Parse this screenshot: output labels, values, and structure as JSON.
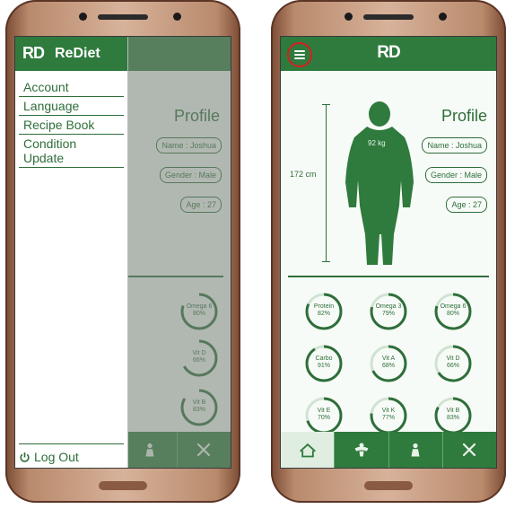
{
  "app": {
    "logo": "RD",
    "name": "ReDiet"
  },
  "drawer": {
    "items": [
      "Account",
      "Language",
      "Recipe Book",
      "Condition Update"
    ],
    "logout": "Log Out"
  },
  "profile": {
    "title": "Profile",
    "name": "Name : Joshua",
    "gender": "Gender : Male",
    "age": "Age : 27",
    "height": "172 cm",
    "weight": "92 kg"
  },
  "nutrients": [
    {
      "name": "Protein",
      "value": "82%"
    },
    {
      "name": "Omega 3",
      "value": "79%"
    },
    {
      "name": "Omega 6",
      "value": "80%"
    },
    {
      "name": "Carbo",
      "value": "91%"
    },
    {
      "name": "Vit A",
      "value": "68%"
    },
    {
      "name": "Vit D",
      "value": "66%"
    },
    {
      "name": "Vit E",
      "value": "70%"
    },
    {
      "name": "Vit K",
      "value": "77%"
    },
    {
      "name": "Vit B",
      "value": "83%"
    }
  ],
  "nav": {
    "items": [
      "home-icon",
      "fitness-icon",
      "profile-icon",
      "tools-icon"
    ],
    "active": 0
  },
  "colors": {
    "primary": "#2f7a3d",
    "highlight": "#d61f1f"
  }
}
